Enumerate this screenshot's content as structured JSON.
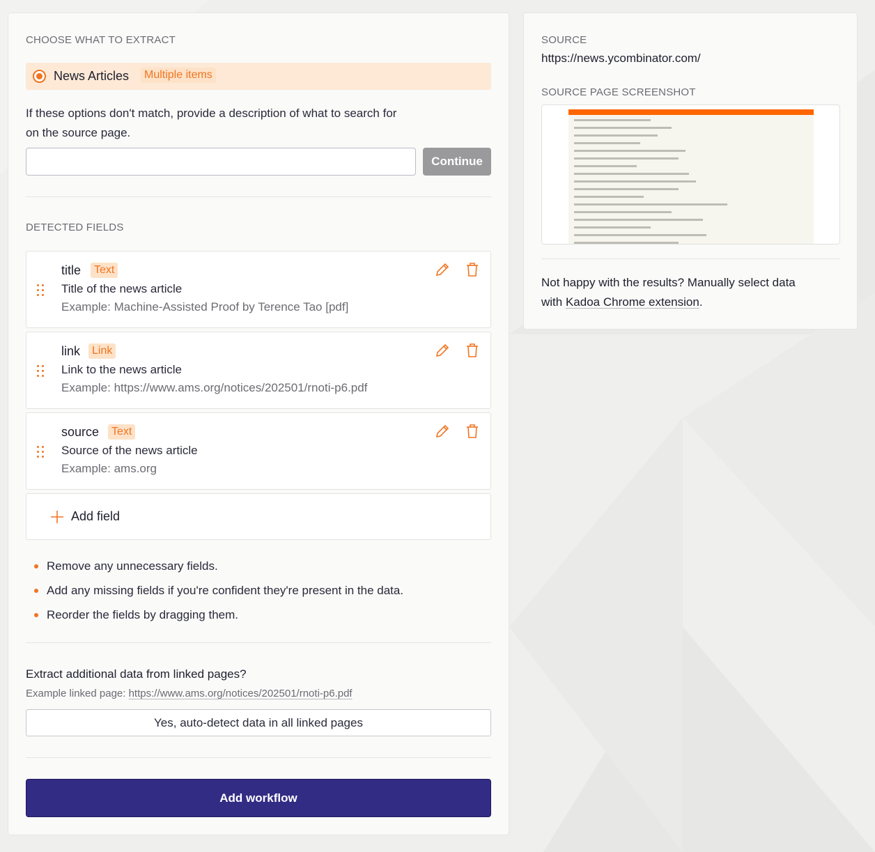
{
  "extract": {
    "heading": "CHOOSE WHAT TO EXTRACT",
    "option_label": "News Articles",
    "option_badge": "Multiple items",
    "help_line1": "If these options don't match, provide a description of what to search for",
    "help_line2": "on the source page.",
    "description_value": "",
    "continue_label": "Continue"
  },
  "fields": {
    "heading": "DETECTED FIELDS",
    "items": [
      {
        "name": "title",
        "type": "Text",
        "description": "Title of the news article",
        "example": "Example: Machine-Assisted Proof by Terence Tao [pdf]"
      },
      {
        "name": "link",
        "type": "Link",
        "description": "Link to the news article",
        "example": "Example: https://www.ams.org/notices/202501/rnoti-p6.pdf"
      },
      {
        "name": "source",
        "type": "Text",
        "description": "Source of the news article",
        "example": "Example: ams.org"
      }
    ],
    "add_label": "Add field"
  },
  "tips": [
    "Remove any unnecessary fields.",
    "Add any missing fields if you're confident they're present in the data.",
    "Reorder the fields by dragging them."
  ],
  "linked": {
    "question": "Extract additional data from linked pages?",
    "example_prefix": "Example linked page: ",
    "example_url": "https://www.ams.org/notices/202501/rnoti-p6.pdf",
    "button_label": "Yes, auto-detect data in all linked pages"
  },
  "workflow_button": "Add workflow",
  "source": {
    "heading": "SOURCE",
    "url": "https://news.ycombinator.com/",
    "screenshot_heading": "SOURCE PAGE SCREENSHOT",
    "manual_line1": "Not happy with the results? Manually select data",
    "manual_prefix": "with ",
    "manual_link": "Kadoa Chrome extension",
    "manual_suffix": "."
  },
  "colors": {
    "accent": "#f07521",
    "primary_button": "#332c85",
    "option_bg": "#fde9d6",
    "disabled_button": "#9a9a9c"
  },
  "icons": [
    "drag-handle-icon",
    "pencil-icon",
    "trash-icon",
    "plus-icon"
  ]
}
